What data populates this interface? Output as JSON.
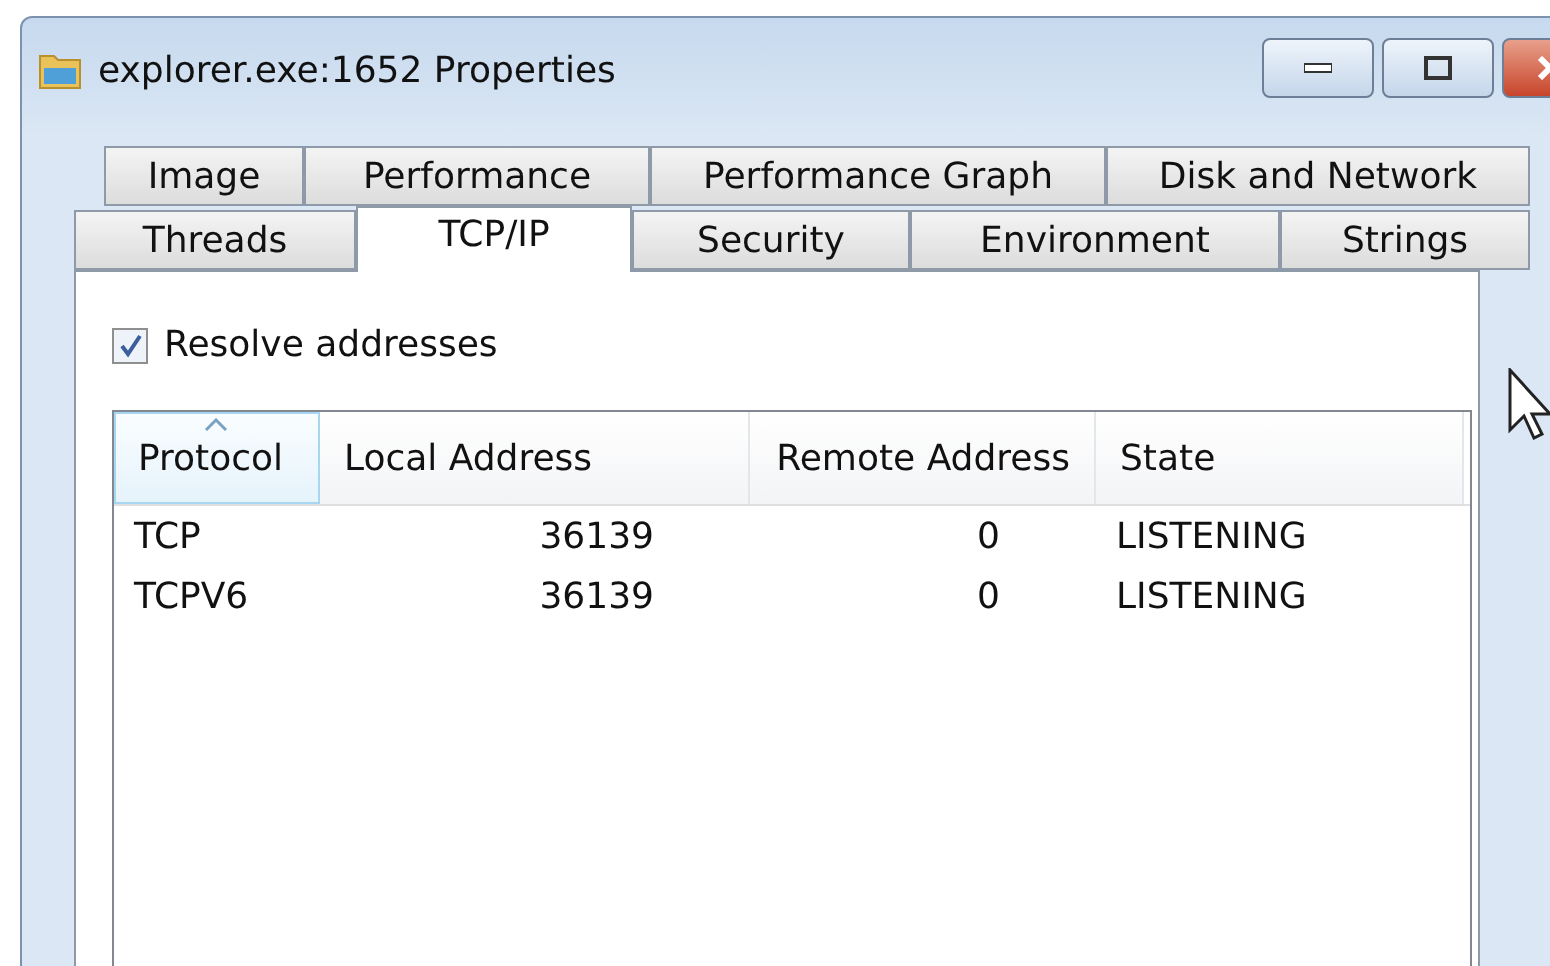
{
  "window": {
    "title": "explorer.exe:1652 Properties",
    "buttons": [
      {
        "kind": "minimize"
      },
      {
        "kind": "maximize"
      },
      {
        "kind": "close"
      }
    ]
  },
  "tab_rows": [
    [
      {
        "label": "Image",
        "selected": false
      },
      {
        "label": "Performance",
        "selected": false
      },
      {
        "label": "Performance Graph",
        "selected": false
      },
      {
        "label": "Disk and Network",
        "selected": false
      }
    ],
    [
      {
        "label": "Threads",
        "selected": false
      },
      {
        "label": "TCP/IP",
        "selected": true
      },
      {
        "label": "Security",
        "selected": false
      },
      {
        "label": "Environment",
        "selected": false
      },
      {
        "label": "Strings",
        "selected": false
      }
    ]
  ],
  "resolve_addresses": {
    "label": "Resolve addresses",
    "checked": true
  },
  "table": {
    "columns": [
      {
        "label": "Protocol",
        "sorted": true
      },
      {
        "label": "Local Address",
        "sorted": false
      },
      {
        "label": "Remote Address",
        "sorted": false
      },
      {
        "label": "State",
        "sorted": false
      }
    ],
    "rows": [
      [
        "TCP",
        "36139",
        "0",
        "LISTENING"
      ],
      [
        "TCPV6",
        "36139",
        "0",
        "LISTENING"
      ]
    ]
  }
}
